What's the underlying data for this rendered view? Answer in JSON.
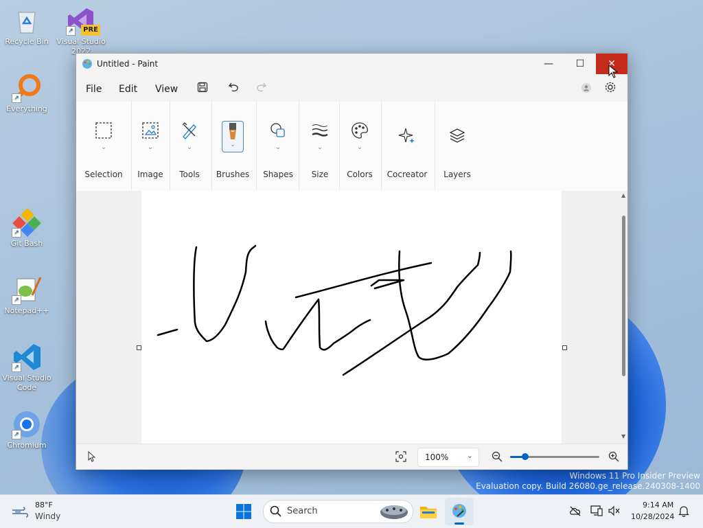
{
  "desktop": {
    "icons": [
      {
        "label": "Recycle Bin"
      },
      {
        "label": "Visual Studio 2022",
        "badge": "PRE"
      },
      {
        "label": "Everything"
      },
      {
        "label": "Git Bash"
      },
      {
        "label": "Notepad++"
      },
      {
        "label": "Visual Studio Code"
      },
      {
        "label": "Chromium"
      }
    ],
    "watermark": {
      "line1": "Windows 11 Pro Insider Preview",
      "line2": "Evaluation copy. Build 26080.ge_release.240308-1400"
    }
  },
  "window": {
    "title": "Untitled - Paint",
    "controls": {
      "minimize": "—",
      "maximize": "☐",
      "close": "✕"
    }
  },
  "menu": {
    "items": [
      "File",
      "Edit",
      "View"
    ]
  },
  "ribbon": {
    "groups": [
      "Selection",
      "Image",
      "Tools",
      "Brushes",
      "Shapes",
      "Size",
      "Colors",
      "Cocreator",
      "Layers"
    ]
  },
  "status": {
    "zoom": "100%"
  },
  "taskbar": {
    "weather": {
      "temp": "88°F",
      "condition": "Windy"
    },
    "search_placeholder": "Search",
    "time": "9:14 AM",
    "date": "10/28/2024"
  },
  "colors": {
    "close_hover": "#c42b1c",
    "accent": "#0067c0",
    "stroke": "#000000"
  }
}
